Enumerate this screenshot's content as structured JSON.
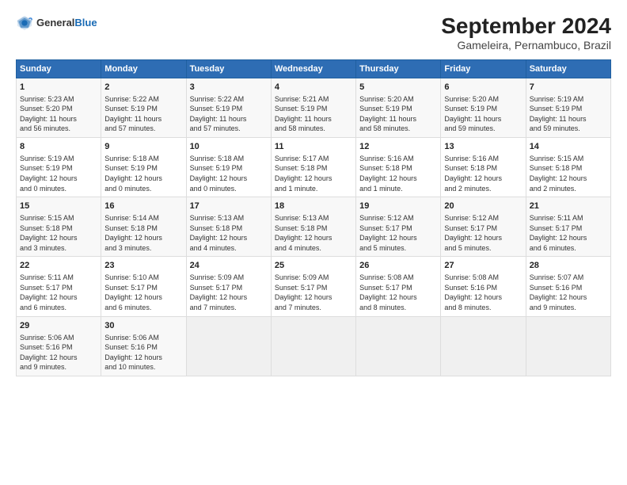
{
  "logo": {
    "general": "General",
    "blue": "Blue"
  },
  "title": "September 2024",
  "subtitle": "Gameleira, Pernambuco, Brazil",
  "headers": [
    "Sunday",
    "Monday",
    "Tuesday",
    "Wednesday",
    "Thursday",
    "Friday",
    "Saturday"
  ],
  "weeks": [
    [
      {
        "day": "1",
        "info": "Sunrise: 5:23 AM\nSunset: 5:20 PM\nDaylight: 11 hours\nand 56 minutes."
      },
      {
        "day": "2",
        "info": "Sunrise: 5:22 AM\nSunset: 5:19 PM\nDaylight: 11 hours\nand 57 minutes."
      },
      {
        "day": "3",
        "info": "Sunrise: 5:22 AM\nSunset: 5:19 PM\nDaylight: 11 hours\nand 57 minutes."
      },
      {
        "day": "4",
        "info": "Sunrise: 5:21 AM\nSunset: 5:19 PM\nDaylight: 11 hours\nand 58 minutes."
      },
      {
        "day": "5",
        "info": "Sunrise: 5:20 AM\nSunset: 5:19 PM\nDaylight: 11 hours\nand 58 minutes."
      },
      {
        "day": "6",
        "info": "Sunrise: 5:20 AM\nSunset: 5:19 PM\nDaylight: 11 hours\nand 59 minutes."
      },
      {
        "day": "7",
        "info": "Sunrise: 5:19 AM\nSunset: 5:19 PM\nDaylight: 11 hours\nand 59 minutes."
      }
    ],
    [
      {
        "day": "8",
        "info": "Sunrise: 5:19 AM\nSunset: 5:19 PM\nDaylight: 12 hours\nand 0 minutes."
      },
      {
        "day": "9",
        "info": "Sunrise: 5:18 AM\nSunset: 5:19 PM\nDaylight: 12 hours\nand 0 minutes."
      },
      {
        "day": "10",
        "info": "Sunrise: 5:18 AM\nSunset: 5:19 PM\nDaylight: 12 hours\nand 0 minutes."
      },
      {
        "day": "11",
        "info": "Sunrise: 5:17 AM\nSunset: 5:18 PM\nDaylight: 12 hours\nand 1 minute."
      },
      {
        "day": "12",
        "info": "Sunrise: 5:16 AM\nSunset: 5:18 PM\nDaylight: 12 hours\nand 1 minute."
      },
      {
        "day": "13",
        "info": "Sunrise: 5:16 AM\nSunset: 5:18 PM\nDaylight: 12 hours\nand 2 minutes."
      },
      {
        "day": "14",
        "info": "Sunrise: 5:15 AM\nSunset: 5:18 PM\nDaylight: 12 hours\nand 2 minutes."
      }
    ],
    [
      {
        "day": "15",
        "info": "Sunrise: 5:15 AM\nSunset: 5:18 PM\nDaylight: 12 hours\nand 3 minutes."
      },
      {
        "day": "16",
        "info": "Sunrise: 5:14 AM\nSunset: 5:18 PM\nDaylight: 12 hours\nand 3 minutes."
      },
      {
        "day": "17",
        "info": "Sunrise: 5:13 AM\nSunset: 5:18 PM\nDaylight: 12 hours\nand 4 minutes."
      },
      {
        "day": "18",
        "info": "Sunrise: 5:13 AM\nSunset: 5:18 PM\nDaylight: 12 hours\nand 4 minutes."
      },
      {
        "day": "19",
        "info": "Sunrise: 5:12 AM\nSunset: 5:17 PM\nDaylight: 12 hours\nand 5 minutes."
      },
      {
        "day": "20",
        "info": "Sunrise: 5:12 AM\nSunset: 5:17 PM\nDaylight: 12 hours\nand 5 minutes."
      },
      {
        "day": "21",
        "info": "Sunrise: 5:11 AM\nSunset: 5:17 PM\nDaylight: 12 hours\nand 6 minutes."
      }
    ],
    [
      {
        "day": "22",
        "info": "Sunrise: 5:11 AM\nSunset: 5:17 PM\nDaylight: 12 hours\nand 6 minutes."
      },
      {
        "day": "23",
        "info": "Sunrise: 5:10 AM\nSunset: 5:17 PM\nDaylight: 12 hours\nand 6 minutes."
      },
      {
        "day": "24",
        "info": "Sunrise: 5:09 AM\nSunset: 5:17 PM\nDaylight: 12 hours\nand 7 minutes."
      },
      {
        "day": "25",
        "info": "Sunrise: 5:09 AM\nSunset: 5:17 PM\nDaylight: 12 hours\nand 7 minutes."
      },
      {
        "day": "26",
        "info": "Sunrise: 5:08 AM\nSunset: 5:17 PM\nDaylight: 12 hours\nand 8 minutes."
      },
      {
        "day": "27",
        "info": "Sunrise: 5:08 AM\nSunset: 5:16 PM\nDaylight: 12 hours\nand 8 minutes."
      },
      {
        "day": "28",
        "info": "Sunrise: 5:07 AM\nSunset: 5:16 PM\nDaylight: 12 hours\nand 9 minutes."
      }
    ],
    [
      {
        "day": "29",
        "info": "Sunrise: 5:06 AM\nSunset: 5:16 PM\nDaylight: 12 hours\nand 9 minutes."
      },
      {
        "day": "30",
        "info": "Sunrise: 5:06 AM\nSunset: 5:16 PM\nDaylight: 12 hours\nand 10 minutes."
      },
      {
        "day": "",
        "info": ""
      },
      {
        "day": "",
        "info": ""
      },
      {
        "day": "",
        "info": ""
      },
      {
        "day": "",
        "info": ""
      },
      {
        "day": "",
        "info": ""
      }
    ]
  ]
}
